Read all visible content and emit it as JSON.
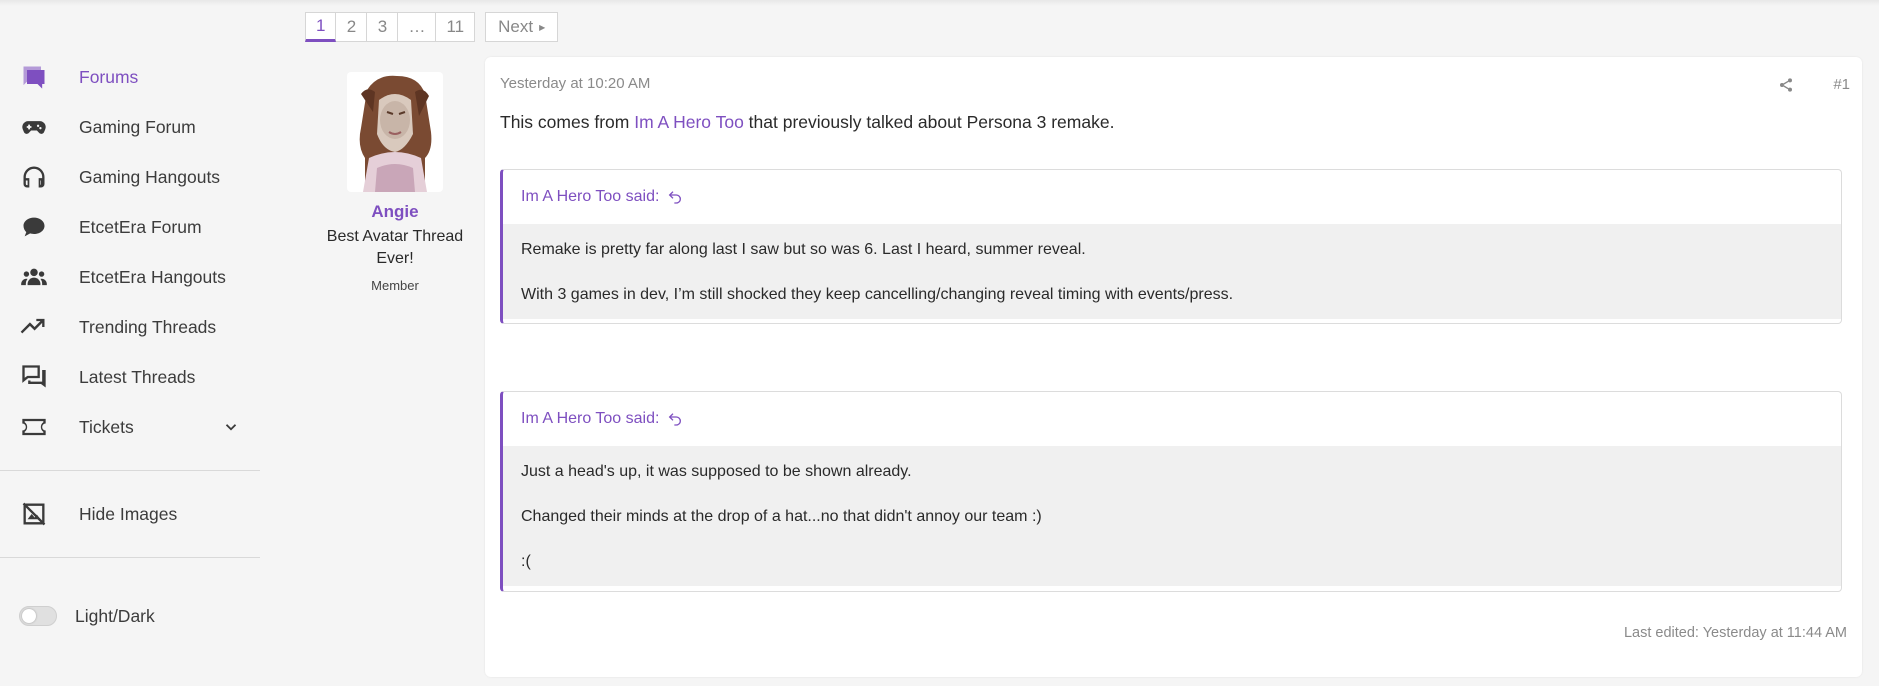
{
  "sidebar": {
    "items": [
      {
        "label": "Forums",
        "icon": "forums-icon",
        "active": true
      },
      {
        "label": "Gaming Forum",
        "icon": "gamepad-icon"
      },
      {
        "label": "Gaming Hangouts",
        "icon": "headphones-icon"
      },
      {
        "label": "EtcetEra Forum",
        "icon": "chat-bubble-icon"
      },
      {
        "label": "EtcetEra Hangouts",
        "icon": "users-icon"
      },
      {
        "label": "Trending Threads",
        "icon": "trending-icon"
      },
      {
        "label": "Latest Threads",
        "icon": "comments-icon"
      },
      {
        "label": "Tickets",
        "icon": "ticket-icon"
      }
    ],
    "hide_images": "Hide Images",
    "theme_toggle": "Light/Dark"
  },
  "pagination": {
    "pages": [
      "1",
      "2",
      "3",
      "…",
      "11"
    ],
    "current": "1",
    "next": "Next"
  },
  "user": {
    "name": "Angie",
    "title": "Best Avatar Thread Ever!",
    "role": "Member"
  },
  "post": {
    "date": "Yesterday at 10:20 AM",
    "number": "#1",
    "body_prefix": "This comes from ",
    "body_link": "Im A Hero Too",
    "body_suffix": " that previously talked about Persona 3 remake.",
    "quotes": [
      {
        "author": "Im A Hero Too said:",
        "lines": [
          "Remake is pretty far along last I saw but so was 6. Last I heard, summer reveal.",
          "With 3 games in dev, I’m still shocked they keep cancelling/changing reveal timing with events/press."
        ]
      },
      {
        "author": "Im A Hero Too said:",
        "lines": [
          "Just a head's up, it was supposed to be shown already.",
          "Changed their minds at the drop of a hat...no that didn't annoy our team :)",
          ":("
        ]
      }
    ],
    "last_edited": "Last edited: Yesterday at 11:44 AM"
  },
  "colors": {
    "accent": "#7e4fc0",
    "background": "#f5f5f5",
    "quote_bg": "#f0f0f0"
  }
}
